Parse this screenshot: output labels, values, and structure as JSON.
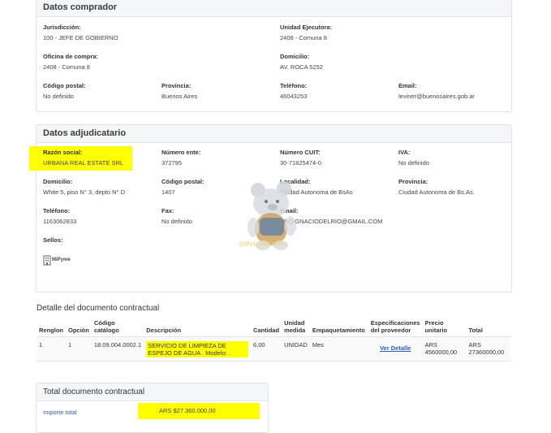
{
  "comprador": {
    "title": "Datos comprador",
    "jurisdiccion": {
      "label": "Jurisdicción:",
      "value": "100 - JEFE DE GOBIERNO"
    },
    "unidad_ejecutora": {
      "label": "Unidad Ejecutora:",
      "value": "2408 - Comuna 8"
    },
    "oficina_compra": {
      "label": "Oficina de compra:",
      "value": "2408 - Comuna 8"
    },
    "domicilio": {
      "label": "Domicilio:",
      "value": "AV. ROCA 5252"
    },
    "codigo_postal": {
      "label": "Código postal:",
      "value": "No definido"
    },
    "provincia": {
      "label": "Provincia:",
      "value": "Buenos Aires"
    },
    "telefono": {
      "label": "Teléfono:",
      "value": "46043253"
    },
    "email": {
      "label": "Email:",
      "value": "leviner@buenosaires.gob.ar"
    }
  },
  "adjudicatario": {
    "title": "Datos adjudicatario",
    "razon_social": {
      "label": "Razón social:",
      "value": "URBANA REAL ESTATE SRL"
    },
    "numero_ente": {
      "label": "Número ente:",
      "value": "372795"
    },
    "numero_cuit": {
      "label": "Número CUIT:",
      "value": "30-71825474-0"
    },
    "iva": {
      "label": "IVA:",
      "value": "No definido"
    },
    "domicilio": {
      "label": "Domicilio:",
      "value": "White 5, piso N° 3, depto N° D"
    },
    "codigo_postal": {
      "label": "Código postal:",
      "value": "1407"
    },
    "localidad": {
      "label": "Localidad:",
      "value": "Ciudad Autonoma de BsAs"
    },
    "provincia": {
      "label": "Provincia:",
      "value": "Ciudad Autonoma de Bs.As."
    },
    "telefono": {
      "label": "Teléfono:",
      "value": "1163062833"
    },
    "fax": {
      "label": "Fax:",
      "value": "No definido"
    },
    "email": {
      "label": "Email:",
      "value": "ARQIGNACIODELRIO@GMAIL.COM"
    },
    "sellos": {
      "label": "Sellos:",
      "badge": "MiPyme"
    }
  },
  "detalle": {
    "title": "Detalle del documento contractual",
    "headers": [
      "Renglon",
      "Opción",
      "Código catálogo",
      "Descripción",
      "Cantidad",
      "Unidad medida",
      "Empaquetamiento",
      "Especificaciones del proveedor",
      "Precio unitario",
      "Total"
    ],
    "row": {
      "renglon": "1",
      "opcion": "1",
      "codigo": "18.09.004.0002.1",
      "descripcion": "SERVICIO DE LIMPIEZA DE ESPEJO DE AGUA . Modelo: .",
      "cantidad": "6,00",
      "unidad": "UNIDAD",
      "empaquetamiento": "Mes",
      "especificaciones": "Ver Detalle",
      "precio_unitario": "ARS 4560000,00",
      "total": "ARS 27360000,00"
    }
  },
  "total_documento": {
    "title": "Total documento contractual",
    "label": "Importe total",
    "value": "ARS $27.360.000,00"
  },
  "watermark": {
    "text": "@PetoAmarillo"
  },
  "colors": {
    "highlight": "#ffff00",
    "link": "#2c60b3",
    "header_bg": "#f5f6f7"
  }
}
